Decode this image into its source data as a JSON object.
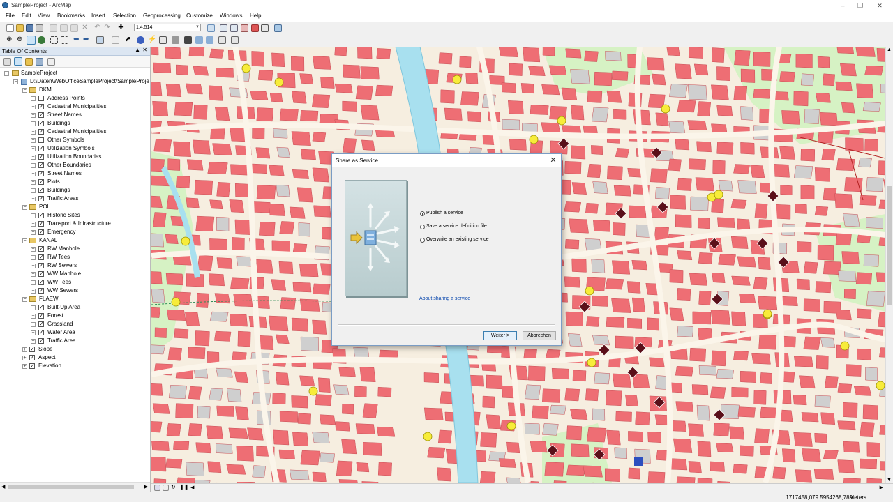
{
  "window": {
    "title": "SampleProject - ArcMap"
  },
  "menu": [
    "File",
    "Edit",
    "View",
    "Bookmarks",
    "Insert",
    "Selection",
    "Geoprocessing",
    "Customize",
    "Windows",
    "Help"
  ],
  "toolbar": {
    "scale": "1:4.514"
  },
  "toc": {
    "title": "Table Of Contents",
    "project": "SampleProject",
    "path": "D:\\Daten\\WebOfficeSampleProject\\SampleProje",
    "groups": [
      {
        "name": "DKM",
        "layers": [
          "Address Points",
          "Cadastral Municipalities",
          "Street Names",
          "Buildings",
          "Cadastral Municipalities",
          "Other Symbols",
          "Utilization Symbols",
          "Utilization Boundaries",
          "Other Boundaries",
          "Street Names",
          "Plots",
          "Buildings",
          "Traffic Areas"
        ]
      },
      {
        "name": "POI",
        "layers": [
          "Historic Sites",
          "Transport & Infrastructure",
          "Emergency"
        ]
      },
      {
        "name": "KANAL",
        "layers": [
          "RW Manhole",
          "RW Tees",
          "RW Sewers",
          "WW Manhole",
          "WW Tees",
          "WW Sewers"
        ]
      },
      {
        "name": "FLAEWI",
        "layers": [
          "Built-Up Area",
          "Forest",
          "Grassland",
          "Water Area",
          "Traffic Area"
        ]
      }
    ],
    "rasters": [
      "Slope",
      "Aspect",
      "Elevation"
    ]
  },
  "dialog": {
    "title": "Share as Service",
    "options": [
      "Publish a service",
      "Save a service definition file",
      "Overwrite an existing service"
    ],
    "selected": 0,
    "link": "About sharing a service",
    "next_button": "Weiter >",
    "cancel_button": "Abbrechen"
  },
  "status": {
    "coordinates": "1717458,079  5954268,789",
    "units": "Meters"
  },
  "colors": {
    "building": "#ee6e74",
    "water": "#a8e0ef",
    "park": "#d6f2c4",
    "dialog_border": "#7a9cc4"
  }
}
